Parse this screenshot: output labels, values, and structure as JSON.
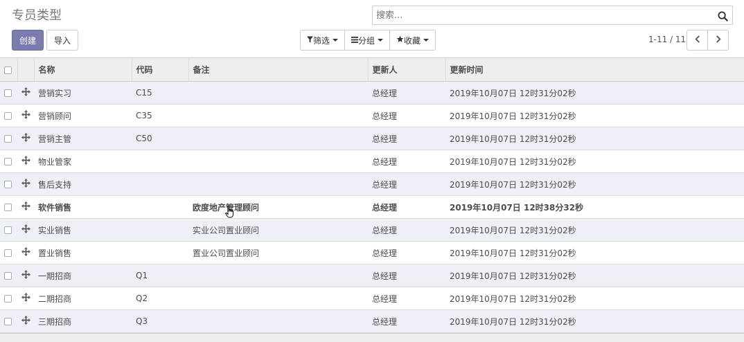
{
  "page": {
    "title": "专员类型"
  },
  "search": {
    "placeholder": "搜索..."
  },
  "buttons": {
    "create": "创建",
    "import": "导入"
  },
  "filters": {
    "filter": "筛选",
    "group": "分组",
    "favorites": "收藏"
  },
  "pager": {
    "value": "1-11 / 11"
  },
  "table": {
    "headers": {
      "name": "名称",
      "code": "代码",
      "note": "备注",
      "updated_by": "更新人",
      "updated_at": "更新时间"
    },
    "rows": [
      {
        "name": "营销实习",
        "code": "C15",
        "note": "",
        "updated_by": "总经理",
        "updated_at": "2019年10月07日 12时31分02秒"
      },
      {
        "name": "营销顾问",
        "code": "C35",
        "note": "",
        "updated_by": "总经理",
        "updated_at": "2019年10月07日 12时31分02秒"
      },
      {
        "name": "营销主管",
        "code": "C50",
        "note": "",
        "updated_by": "总经理",
        "updated_at": "2019年10月07日 12时31分02秒"
      },
      {
        "name": "物业管家",
        "code": "",
        "note": "",
        "updated_by": "总经理",
        "updated_at": "2019年10月07日 12时31分02秒"
      },
      {
        "name": "售后支持",
        "code": "",
        "note": "",
        "updated_by": "总经理",
        "updated_at": "2019年10月07日 12时31分02秒"
      },
      {
        "name": "软件销售",
        "code": "",
        "note": "欧度地产管理顾问",
        "updated_by": "总经理",
        "updated_at": "2019年10月07日 12时38分32秒"
      },
      {
        "name": "实业销售",
        "code": "",
        "note": "实业公司置业顾问",
        "updated_by": "总经理",
        "updated_at": "2019年10月07日 12时31分02秒"
      },
      {
        "name": "置业销售",
        "code": "",
        "note": "置业公司置业顾问",
        "updated_by": "总经理",
        "updated_at": "2019年10月07日 12时31分02秒"
      },
      {
        "name": "一期招商",
        "code": "Q1",
        "note": "",
        "updated_by": "总经理",
        "updated_at": "2019年10月07日 12时31分02秒"
      },
      {
        "name": "二期招商",
        "code": "Q2",
        "note": "",
        "updated_by": "总经理",
        "updated_at": "2019年10月07日 12时31分02秒"
      },
      {
        "name": "三期招商",
        "code": "Q3",
        "note": "",
        "updated_by": "总经理",
        "updated_at": "2019年10月07日 12时31分02秒"
      }
    ]
  },
  "colors": {
    "primary": "#7c7bad",
    "row_alt": "#eef0f7",
    "header_bg": "#eeeeee"
  },
  "icons": [
    "search-icon",
    "filter-icon",
    "list-icon",
    "star-icon",
    "chevron-left-icon",
    "chevron-right-icon",
    "drag-handle-icon",
    "hand-cursor-icon"
  ]
}
